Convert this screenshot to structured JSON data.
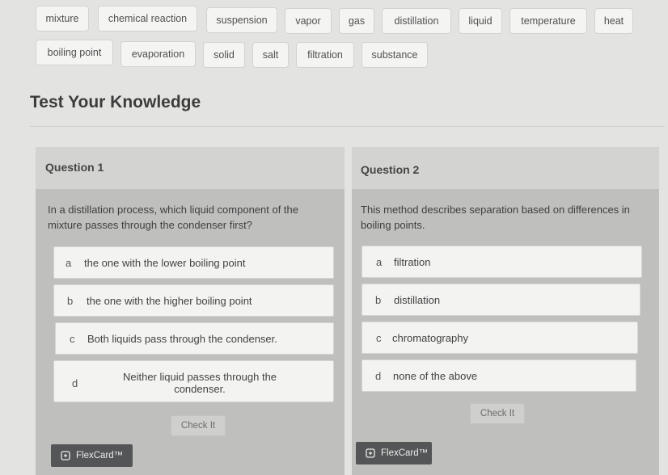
{
  "vocabulary": {
    "row1": [
      "mixture",
      "chemical reaction",
      "suspension",
      "vapor",
      "gas",
      "distillation",
      "liquid",
      "temperature",
      "heat"
    ],
    "row2": [
      "boiling point",
      "evaporation",
      "solid",
      "salt",
      "filtration",
      "substance"
    ]
  },
  "section_title": "Test Your Knowledge",
  "questions": [
    {
      "title": "Question 1",
      "text": "In a distillation process, which liquid component of the mixture passes through the condenser first?",
      "options": [
        {
          "letter": "a",
          "text": "the one with the lower boiling point"
        },
        {
          "letter": "b",
          "text": "the one with the higher boiling point"
        },
        {
          "letter": "c",
          "text": "Both liquids pass through the condenser."
        },
        {
          "letter": "d",
          "text": "Neither liquid passes through the condenser."
        }
      ],
      "check_label": "Check It",
      "flexcard_label": "FlexCard™"
    },
    {
      "title": "Question 2",
      "text": "This method describes separation based on differences in boiling points.",
      "options": [
        {
          "letter": "a",
          "text": "filtration"
        },
        {
          "letter": "b",
          "text": "distillation"
        },
        {
          "letter": "c",
          "text": "chromatography"
        },
        {
          "letter": "d",
          "text": "none of the above"
        }
      ],
      "check_label": "Check It",
      "flexcard_label": "FlexCard™"
    }
  ],
  "icons": {
    "flexcard": "flashcard-icon"
  }
}
